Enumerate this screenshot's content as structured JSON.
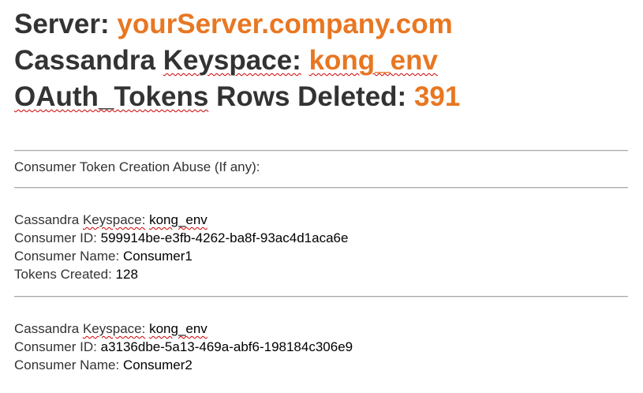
{
  "header": {
    "server_label": "Server:",
    "server_value": "yourServer.company.com",
    "keyspace_label_1": "Cassandra",
    "keyspace_label_2": "Keyspace:",
    "keyspace_value": "kong_env",
    "tokens_label_1": "OAuth_Tokens",
    "tokens_label_2": "Rows Deleted:",
    "tokens_value": "391"
  },
  "abuse_section": {
    "title": "Consumer Token Creation Abuse (If any):"
  },
  "consumers": [
    {
      "keyspace_label_1": "Cassandra",
      "keyspace_label_2": "Keyspace:",
      "keyspace_value": "kong_env",
      "id_label": "Consumer ID:",
      "id_value": "599914be-e3fb-4262-ba8f-93ac4d1aca6e",
      "name_label": "Consumer Name:",
      "name_value": "Consumer1",
      "tokens_label": "Tokens Created:",
      "tokens_value": "128"
    },
    {
      "keyspace_label_1": "Cassandra",
      "keyspace_label_2": "Keyspace:",
      "keyspace_value": "kong_env",
      "id_label": "Consumer ID:",
      "id_value": "a3136dbe-5a13-469a-abf6-198184c306e9",
      "name_label": "Consumer Name:",
      "name_value": "Consumer2"
    }
  ],
  "colors": {
    "accent": "#e87722",
    "text": "#333333",
    "rule": "#a9a9a9"
  }
}
